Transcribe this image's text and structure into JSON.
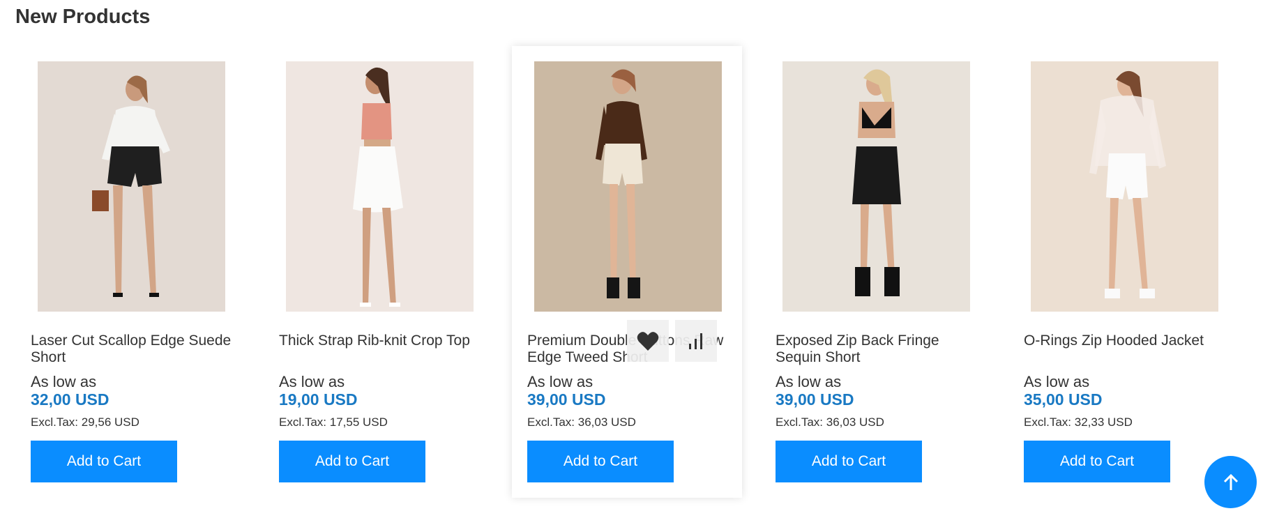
{
  "section": {
    "title": "New Products"
  },
  "products": [
    {
      "name": "Laser Cut Scallop Edge Suede Short",
      "as_low_as": "As low as",
      "price": "32,00 USD",
      "excl_tax": "Excl.Tax: 29,56 USD",
      "cart_label": "Add to Cart"
    },
    {
      "name": "Thick Strap Rib-knit Crop Top",
      "as_low_as": "As low as",
      "price": "19,00 USD",
      "excl_tax": "Excl.Tax: 17,55 USD",
      "cart_label": "Add to Cart"
    },
    {
      "name": "Premium Double Buttons Raw Edge Tweed Short",
      "as_low_as": "As low as",
      "price": "39,00 USD",
      "excl_tax": "Excl.Tax: 36,03 USD",
      "cart_label": "Add to Cart"
    },
    {
      "name": "Exposed Zip Back Fringe Sequin Short",
      "as_low_as": "As low as",
      "price": "39,00 USD",
      "excl_tax": "Excl.Tax: 36,03 USD",
      "cart_label": "Add to Cart"
    },
    {
      "name": "O-Rings Zip Hooded Jacket",
      "as_low_as": "As low as",
      "price": "35,00 USD",
      "excl_tax": "Excl.Tax: 32,33 USD",
      "cart_label": "Add to Cart"
    }
  ],
  "icons": {
    "wishlist": "heart-icon",
    "compare": "bar-chart-icon",
    "scroll_top": "arrow-up-icon"
  },
  "colors": {
    "price": "#1979c3",
    "button": "#0a8dff",
    "text": "#333333"
  }
}
